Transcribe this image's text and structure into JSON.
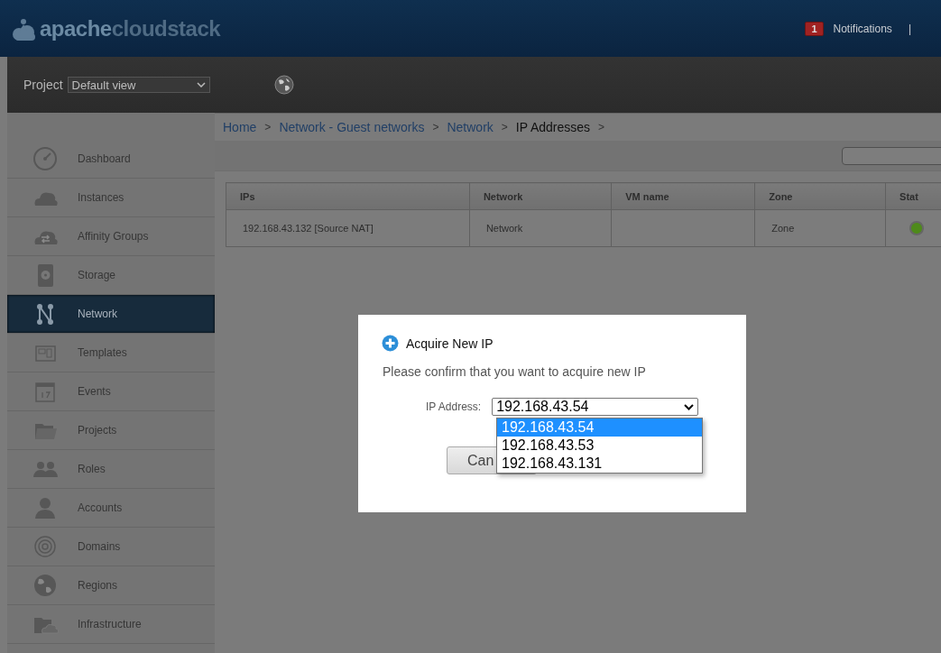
{
  "header": {
    "logo": "**apache**cloudstack",
    "notification_count": "1",
    "notifications": "Notifications",
    "separator": "|"
  },
  "toolbar": {
    "project_label": "Project",
    "project_value": "Default view"
  },
  "sidebar": {
    "items": [
      {
        "label": "Dashboard",
        "selected": false
      },
      {
        "label": "Instances",
        "selected": false
      },
      {
        "label": "Affinity Groups",
        "selected": false
      },
      {
        "label": "Storage",
        "selected": false
      },
      {
        "label": "Network",
        "selected": true
      },
      {
        "label": "Templates",
        "selected": false
      },
      {
        "label": "Events",
        "selected": false
      },
      {
        "label": "Projects",
        "selected": false
      },
      {
        "label": "Roles",
        "selected": false
      },
      {
        "label": "Accounts",
        "selected": false
      },
      {
        "label": "Domains",
        "selected": false
      },
      {
        "label": "Regions",
        "selected": false
      },
      {
        "label": "Infrastructure",
        "selected": false
      }
    ]
  },
  "breadcrumbs": [
    {
      "label": "Home",
      "current": false
    },
    {
      "label": "Network - Guest networks",
      "current": false
    },
    {
      "label": "Network",
      "current": false
    },
    {
      "label": "IP Addresses",
      "current": true
    }
  ],
  "breadcrumb_separator": ">",
  "table": {
    "columns": [
      "IPs",
      "Network",
      "VM name",
      "Zone",
      "Stat"
    ],
    "rows": [
      {
        "ips": "192.168.43.132 [Source NAT]",
        "network": "Network",
        "vm_name": "",
        "zone": "Zone"
      }
    ]
  },
  "dialog": {
    "title": "Acquire New IP",
    "message": "Please confirm that you want to acquire new IP",
    "field_label": "IP Address:",
    "field_value": "192.168.43.54",
    "cancel_button": "Can",
    "options": [
      {
        "label": "192.168.43.54",
        "selected": true
      },
      {
        "label": "192.168.43.53",
        "selected": false
      },
      {
        "label": "192.168.43.131",
        "selected": false
      }
    ]
  }
}
